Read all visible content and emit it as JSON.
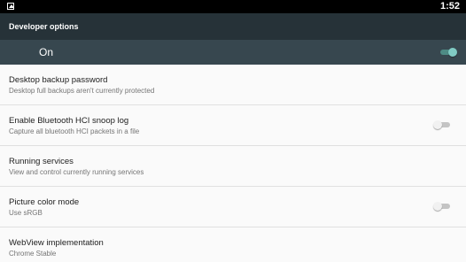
{
  "status_bar": {
    "time": "1:52",
    "left_icon": "image-notification-icon"
  },
  "app_bar": {
    "title": "Developer options"
  },
  "master_switch": {
    "label": "On",
    "checked": true,
    "accent_color": "#80cbc4"
  },
  "settings": [
    {
      "title": "Desktop backup password",
      "summary": "Desktop full backups aren't currently protected",
      "has_switch": false
    },
    {
      "title": "Enable Bluetooth HCI snoop log",
      "summary": "Capture all bluetooth HCI packets in a file",
      "has_switch": true,
      "checked": false
    },
    {
      "title": "Running services",
      "summary": "View and control currently running services",
      "has_switch": false
    },
    {
      "title": "Picture color mode",
      "summary": "Use sRGB",
      "has_switch": true,
      "checked": false
    },
    {
      "title": "WebView implementation",
      "summary": "Chrome Stable",
      "has_switch": false
    }
  ],
  "colors": {
    "status_bar": "#000000",
    "app_bar": "#263238",
    "master_bar": "#37474f",
    "list_background": "#fafafa"
  }
}
